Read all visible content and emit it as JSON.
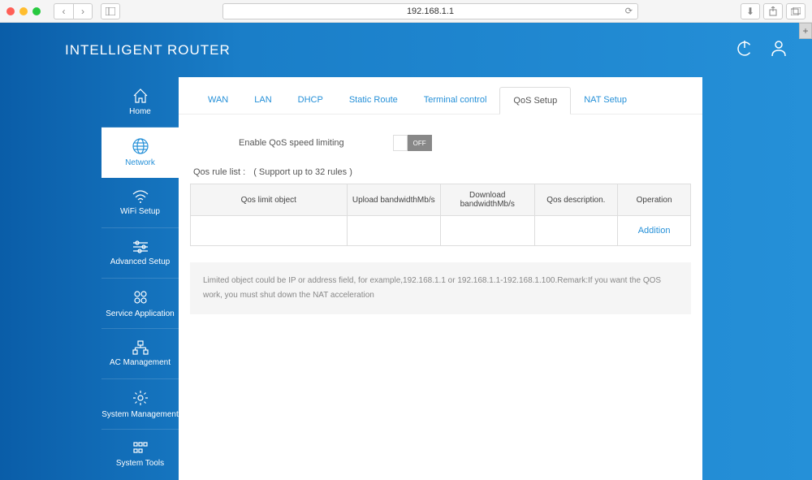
{
  "browser": {
    "url": "192.168.1.1"
  },
  "header": {
    "title": "INTELLIGENT ROUTER"
  },
  "sidebar": {
    "items": [
      {
        "label": "Home"
      },
      {
        "label": "Network"
      },
      {
        "label": "WiFi Setup"
      },
      {
        "label": "Advanced Setup"
      },
      {
        "label": "Service Application"
      },
      {
        "label": "AC Management"
      },
      {
        "label": "System Management"
      },
      {
        "label": "System Tools"
      }
    ]
  },
  "tabs": [
    {
      "label": "WAN"
    },
    {
      "label": "LAN"
    },
    {
      "label": "DHCP"
    },
    {
      "label": "Static Route"
    },
    {
      "label": "Terminal control"
    },
    {
      "label": "QoS Setup"
    },
    {
      "label": "NAT Setup"
    }
  ],
  "qos": {
    "enable_label": "Enable QoS speed limiting",
    "toggle_state": "OFF",
    "rule_list_label": "Qos rule list :",
    "rule_list_note": "( Support up to 32 rules )",
    "table_headers": {
      "object": "Qos limit object",
      "upload": "Upload bandwidthMb/s",
      "download": "Download bandwidthMb/s",
      "description": "Qos description.",
      "operation": "Operation"
    },
    "addition_label": "Addition",
    "remark": "Limited object could be IP or address field, for example,192.168.1.1 or 192.168.1.1-192.168.1.100.Remark:If you want the QOS work, you must shut down the NAT acceleration"
  }
}
